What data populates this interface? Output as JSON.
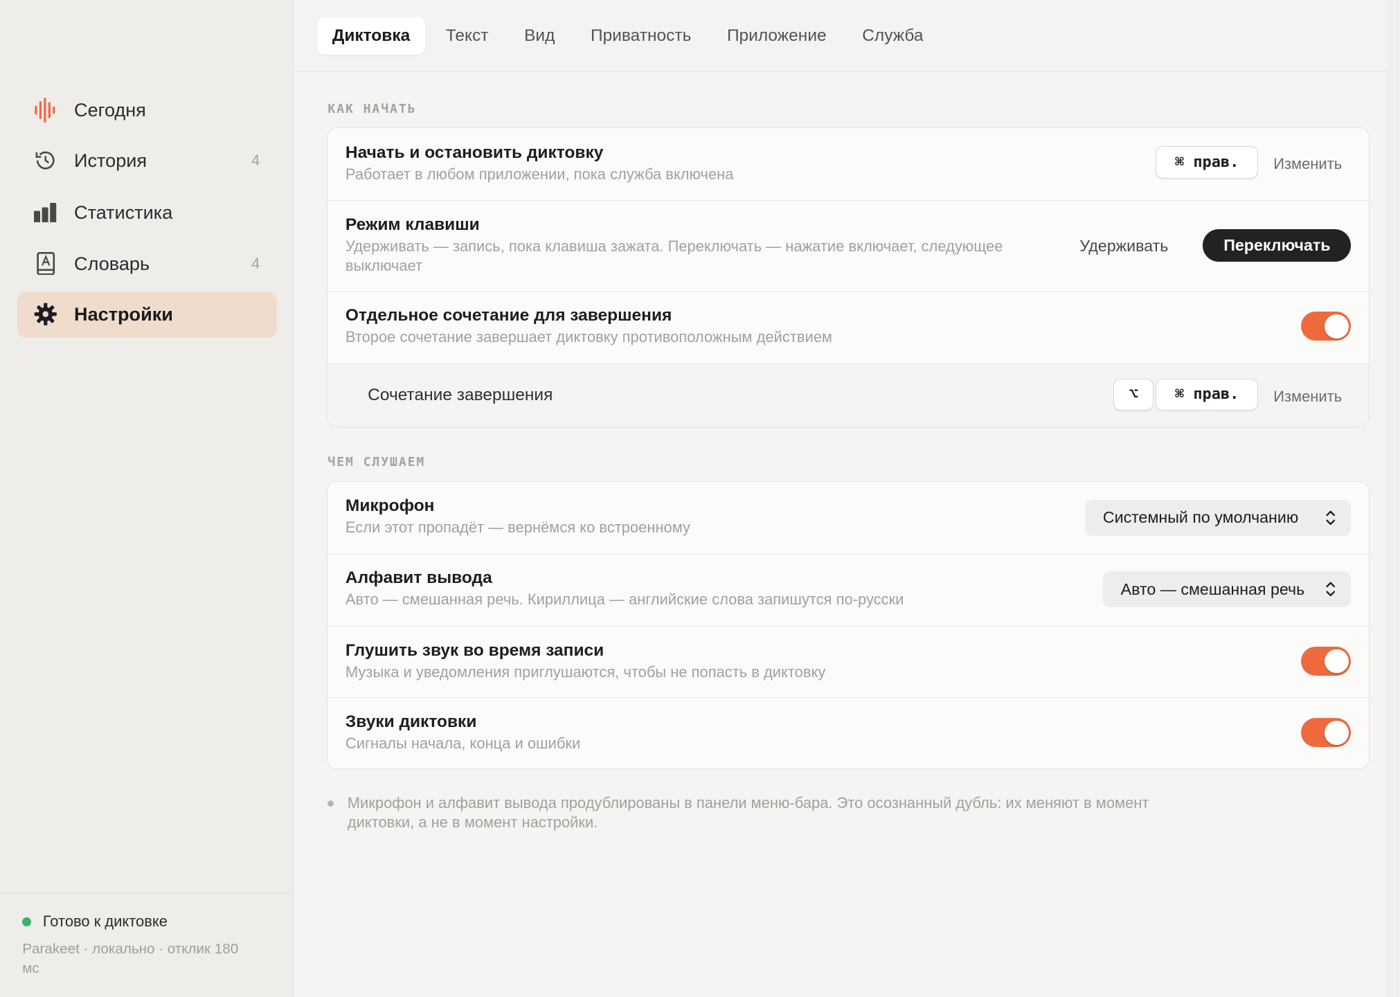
{
  "sidebar": {
    "items": [
      {
        "label": "Сегодня",
        "count": "",
        "icon": "waveform-icon"
      },
      {
        "label": "История",
        "count": "4",
        "icon": "history-clock-icon"
      },
      {
        "label": "Статистика",
        "count": "",
        "icon": "bar-chart-icon"
      },
      {
        "label": "Словарь",
        "count": "4",
        "icon": "dictionary-book-icon"
      },
      {
        "label": "Настройки",
        "count": "",
        "icon": "gear-icon"
      }
    ],
    "active_index": 4,
    "status": {
      "text": "Готово к диктовке",
      "detail": "Parakeet · локально · отклик 180 мс",
      "color": "#37b36a"
    }
  },
  "tabs": [
    "Диктовка",
    "Текст",
    "Вид",
    "Приватность",
    "Приложение",
    "Служба"
  ],
  "active_tab": 0,
  "sections": {
    "start": {
      "title": "КАК НАЧАТЬ",
      "shortcut": {
        "title": "Начать и остановить диктовку",
        "desc": "Работает в любом приложении, пока служба включена",
        "key": "⌘ прав.",
        "change_label": "Изменить"
      },
      "key_mode": {
        "title": "Режим клавиши",
        "desc": "Удерживать — запись, пока клавиша зажата. Переключать — нажатие включает, следующее выключает",
        "option_hold": "Удерживать",
        "option_toggle": "Переключать",
        "selected": "Переключать"
      },
      "separate_stop": {
        "title": "Отдельное сочетание для завершения",
        "desc": "Второе сочетание завершает диктовку противоположным действием",
        "enabled": true
      },
      "stop_shortcut": {
        "title": "Сочетание завершения",
        "key_mod": "⌥",
        "key": "⌘ прав.",
        "change_label": "Изменить"
      }
    },
    "listen": {
      "title": "ЧЕМ СЛУШАЕМ",
      "microphone": {
        "title": "Микрофон",
        "desc": "Если этот пропадёт — вернёмся ко встроенному",
        "value": "Системный по умолчанию"
      },
      "alphabet": {
        "title": "Алфавит вывода",
        "desc": "Авто — смешанная речь. Кириллица — английские слова запишутся по-русски",
        "value": "Авто — смешанная речь"
      },
      "mute": {
        "title": "Глушить звук во время записи",
        "desc": "Музыка и уведомления приглушаются, чтобы не попасть в диктовку",
        "enabled": true
      },
      "sounds": {
        "title": "Звуки диктовки",
        "desc": "Сигналы начала, конца и ошибки",
        "enabled": true
      }
    }
  },
  "note": "Микрофон и алфавит вывода продублированы в панели меню-бара. Это осознанный дубль: их меняют в момент диктовки, а не в момент настройки.",
  "colors": {
    "accent": "#ee6a3e",
    "sidebar_active": "#f0dccd",
    "status_ready": "#37b36a"
  }
}
